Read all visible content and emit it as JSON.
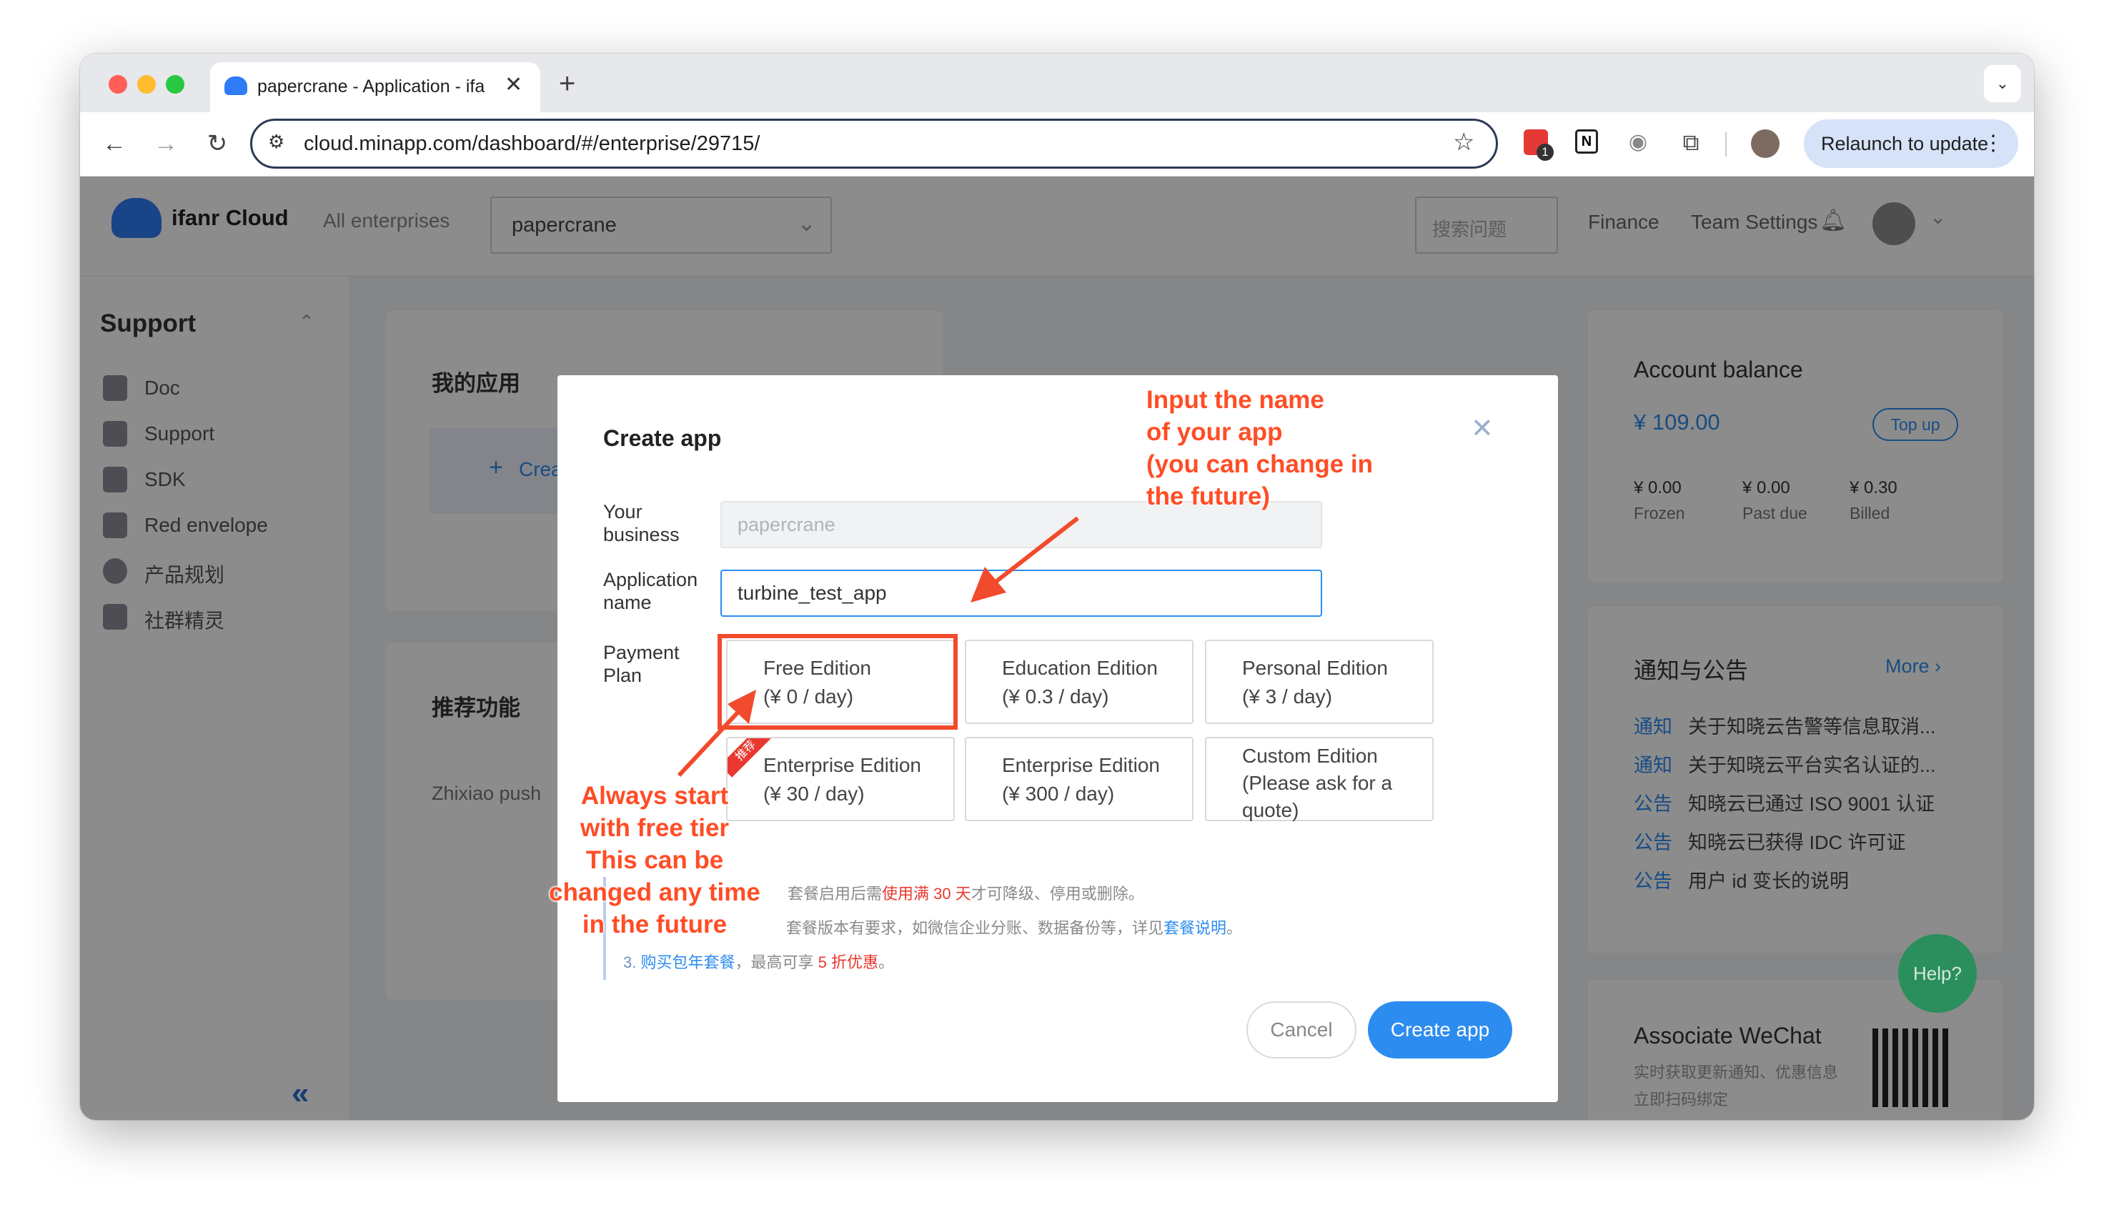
{
  "browser": {
    "tab_title": "papercrane - Application - ifa",
    "url": "cloud.minapp.com/dashboard/#/enterprise/29715/",
    "new_tab_label": "+",
    "relaunch_label": "Relaunch to update",
    "extension_badge": "1"
  },
  "header": {
    "brand": "ifanr Cloud",
    "all_enterprises": "All enterprises",
    "enterprise_select": "papercrane",
    "search_placeholder": "搜索问题",
    "finance": "Finance",
    "team_settings": "Team Settings"
  },
  "sidebar": {
    "section": "Support",
    "items": [
      {
        "label": "Doc",
        "icon": "doc-icon"
      },
      {
        "label": "Support",
        "icon": "support-icon"
      },
      {
        "label": "SDK",
        "icon": "sdk-icon"
      },
      {
        "label": "Red envelope",
        "icon": "red-envelope-icon"
      },
      {
        "label": "产品规划",
        "icon": "chat-icon"
      },
      {
        "label": "社群精灵",
        "icon": "community-icon"
      }
    ]
  },
  "main": {
    "my_apps_title": "我的应用",
    "create_partial": "Crea",
    "recommended_title": "推荐功能",
    "zhixiao_push": "Zhixiao push"
  },
  "right": {
    "balance_title": "Account balance",
    "balance_value": "¥ 109.00",
    "top_up": "Top up",
    "stats": [
      {
        "value": "¥ 0.00",
        "label": "Frozen"
      },
      {
        "value": "¥ 0.00",
        "label": "Past due"
      },
      {
        "value": "¥ 0.30",
        "label": "Billed"
      }
    ],
    "notice_title": "通知与公告",
    "notice_more": "More",
    "notices": [
      {
        "tag": "通知",
        "text": "关于知晓云告警等信息取消..."
      },
      {
        "tag": "通知",
        "text": "关于知晓云平台实名认证的..."
      },
      {
        "tag": "公告",
        "text": "知晓云已通过 ISO 9001 认证"
      },
      {
        "tag": "公告",
        "text": "知晓云已获得 IDC 许可证"
      },
      {
        "tag": "公告",
        "text": "用户 id 变长的说明"
      }
    ],
    "help": "Help?",
    "wechat_title": "Associate WeChat",
    "wechat_line1": "实时获取更新通知、优惠信息",
    "wechat_line2": "立即扫码绑定"
  },
  "modal": {
    "title": "Create app",
    "business_label": "Your business",
    "business_value": "papercrane",
    "name_label": "Application name",
    "name_value": "turbine_test_app",
    "plan_label": "Payment Plan",
    "plans": [
      {
        "name": "Free Edition",
        "price": "(¥ 0 / day)"
      },
      {
        "name": "Education Edition",
        "price": "(¥ 0.3 / day)"
      },
      {
        "name": "Personal Edition",
        "price": "(¥ 3 / day)"
      },
      {
        "name": "Enterprise Edition",
        "price": "(¥ 30 / day)"
      },
      {
        "name": "Enterprise Edition",
        "price": "(¥ 300 / day)"
      },
      {
        "name": "Custom Edition",
        "price": "(Please ask for a quote)"
      }
    ],
    "recommend_badge": "推荐",
    "note1_a": "套餐启用后需",
    "note1_b": "使用满 30 天",
    "note1_c": "才可降级、停用或删除。",
    "note2_a": "套餐版本有要求，如微信企业分账、数据备份等，详见",
    "note2_link": "套餐说明",
    "note3_prefix": "3. ",
    "note3_link": "购买包年套餐",
    "note3_mid": "，最高可享 ",
    "note3_highlight": "5 折优惠",
    "cancel": "Cancel",
    "create": "Create app"
  },
  "annotations": {
    "input_hint": [
      "Input the name",
      "of your app",
      "(you can change in",
      "the future)"
    ],
    "free_hint": [
      "Always start",
      "with free tier",
      "This can be",
      "changed any time",
      "in the future"
    ]
  },
  "colors": {
    "accent": "#2d8cf0",
    "annotation": "#ff4d26",
    "danger": "#e8382f"
  }
}
